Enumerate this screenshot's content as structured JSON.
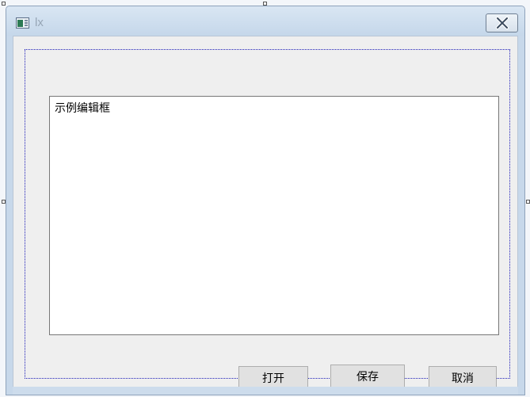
{
  "window": {
    "title": "lx",
    "close_icon": "close-icon"
  },
  "editor": {
    "text": "示例编辑框"
  },
  "buttons": {
    "open_label": "打开",
    "save_label": "保存",
    "cancel_label": "取消"
  }
}
